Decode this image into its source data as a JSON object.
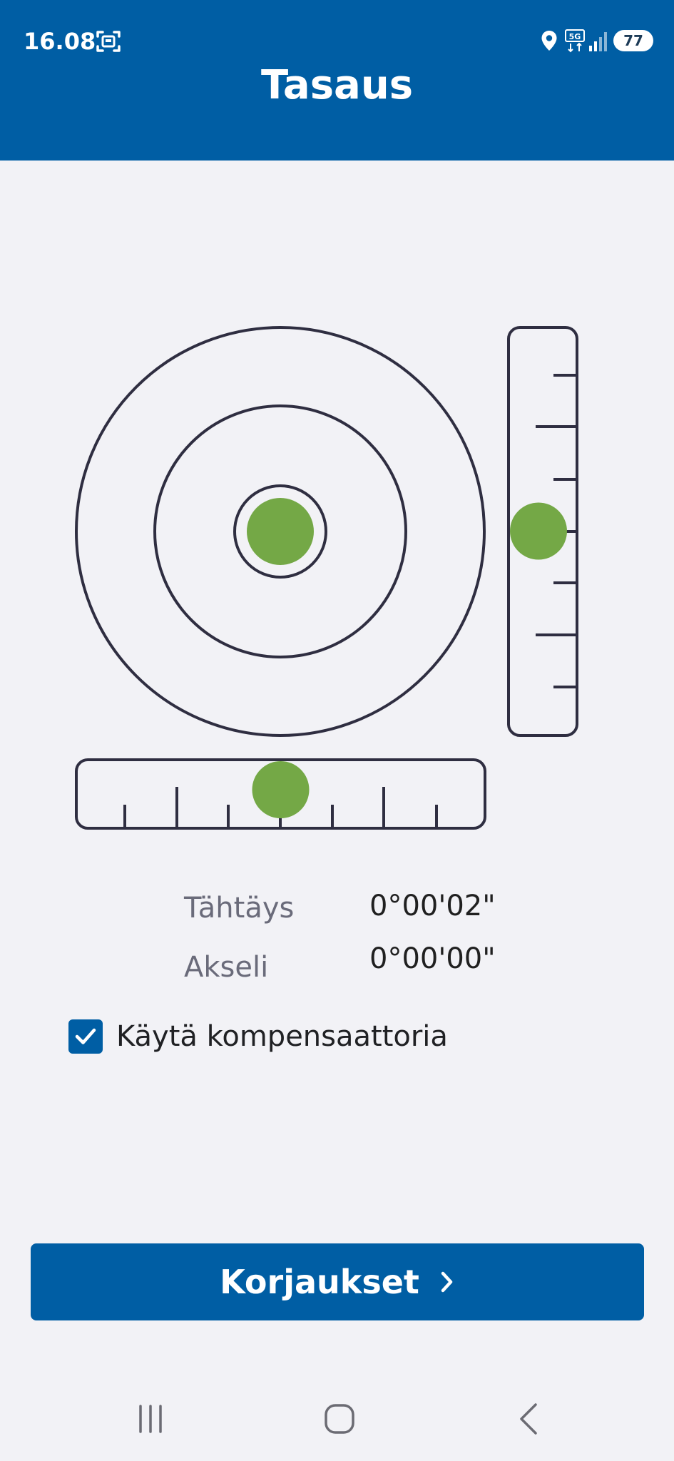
{
  "status_bar": {
    "time": "16.08",
    "battery": "77",
    "network": "5G",
    "icons": [
      "screenshot-icon",
      "location-icon",
      "signal-icon",
      "battery-icon"
    ]
  },
  "header": {
    "title": "Tasaus"
  },
  "level": {
    "circular_bubble_offset": [
      0,
      0
    ],
    "vertical_bubble_fraction": 0.5,
    "horizontal_bubble_fraction": 0.5,
    "bubble_color": "#74a846"
  },
  "readings": [
    {
      "label": "Tähtäys",
      "value": "0°00'02\""
    },
    {
      "label": "Akseli",
      "value": "0°00'00\""
    }
  ],
  "compensator": {
    "label": "Käytä kompensaattoria",
    "checked": true
  },
  "corrections_button": {
    "label": "Korjaukset"
  },
  "colors": {
    "primary": "#005ea4",
    "background": "#f2f2f6",
    "bubble": "#74a846",
    "outline": "#2f2e41"
  },
  "navigation": {
    "buttons": [
      "recent-apps-icon",
      "home-icon",
      "back-icon"
    ]
  }
}
